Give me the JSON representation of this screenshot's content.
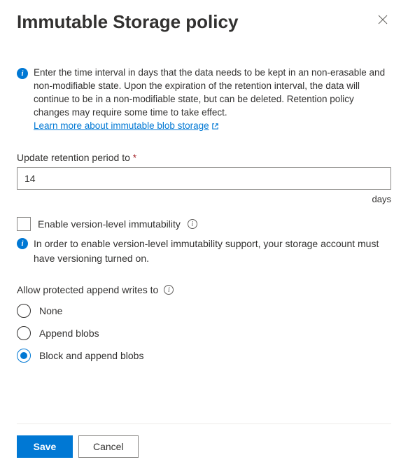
{
  "header": {
    "title": "Immutable Storage policy"
  },
  "info": {
    "text": "Enter the time interval in days that the data needs to be kept in an non-erasable and non-modifiable state. Upon the expiration of the retention interval, the data will continue to be in a non-modifiable state, but can be deleted. Retention policy changes may require some time to take effect.",
    "link_text": "Learn more about immutable blob storage"
  },
  "retention": {
    "label": "Update retention period to",
    "value": "14",
    "unit": "days"
  },
  "versionLevel": {
    "checkbox_label": "Enable version-level immutability",
    "warning_text": "In order to enable version-level immutability support, your storage account must have versioning turned on."
  },
  "appendWrites": {
    "label": "Allow protected append writes to",
    "options": {
      "none": "None",
      "append": "Append blobs",
      "block_append": "Block and append blobs"
    },
    "selected": "block_append"
  },
  "footer": {
    "save": "Save",
    "cancel": "Cancel"
  }
}
